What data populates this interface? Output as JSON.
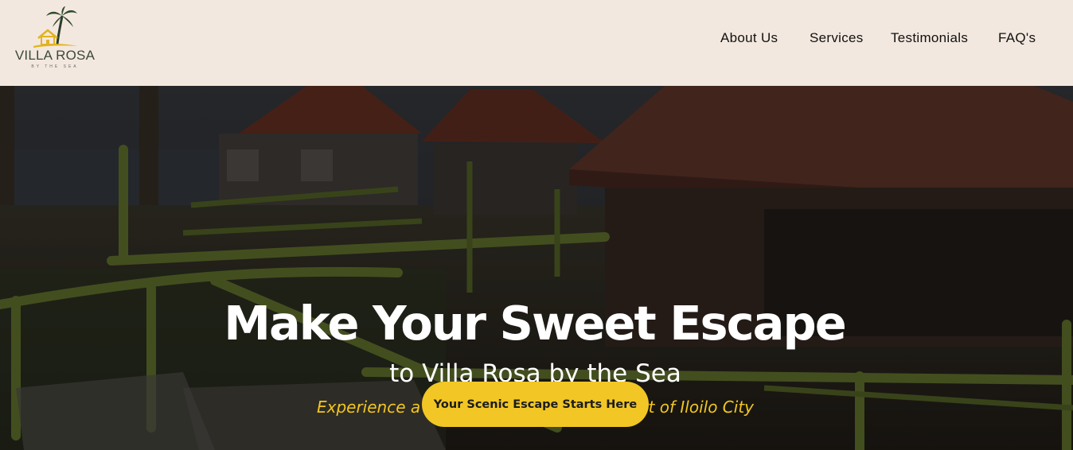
{
  "brand": {
    "name": "VILLA ROSA",
    "tagline": "BY THE SEA"
  },
  "nav": {
    "items": [
      "About Us",
      "Services",
      "Testimonials",
      "FAQ's"
    ]
  },
  "hero": {
    "title": "Make Your Sweet Escape",
    "subtitle": "to Villa Rosa by the Sea",
    "tagline": "Experience a relaxing Retreat in the Heart of Iloilo City",
    "cta_label": "Your Scenic Escape Starts Here"
  },
  "colors": {
    "header_bg": "#f3e8df",
    "accent": "#f2c624",
    "tagline": "#f2c61f"
  },
  "icons": {
    "logo": "palm-tree-house-icon"
  }
}
